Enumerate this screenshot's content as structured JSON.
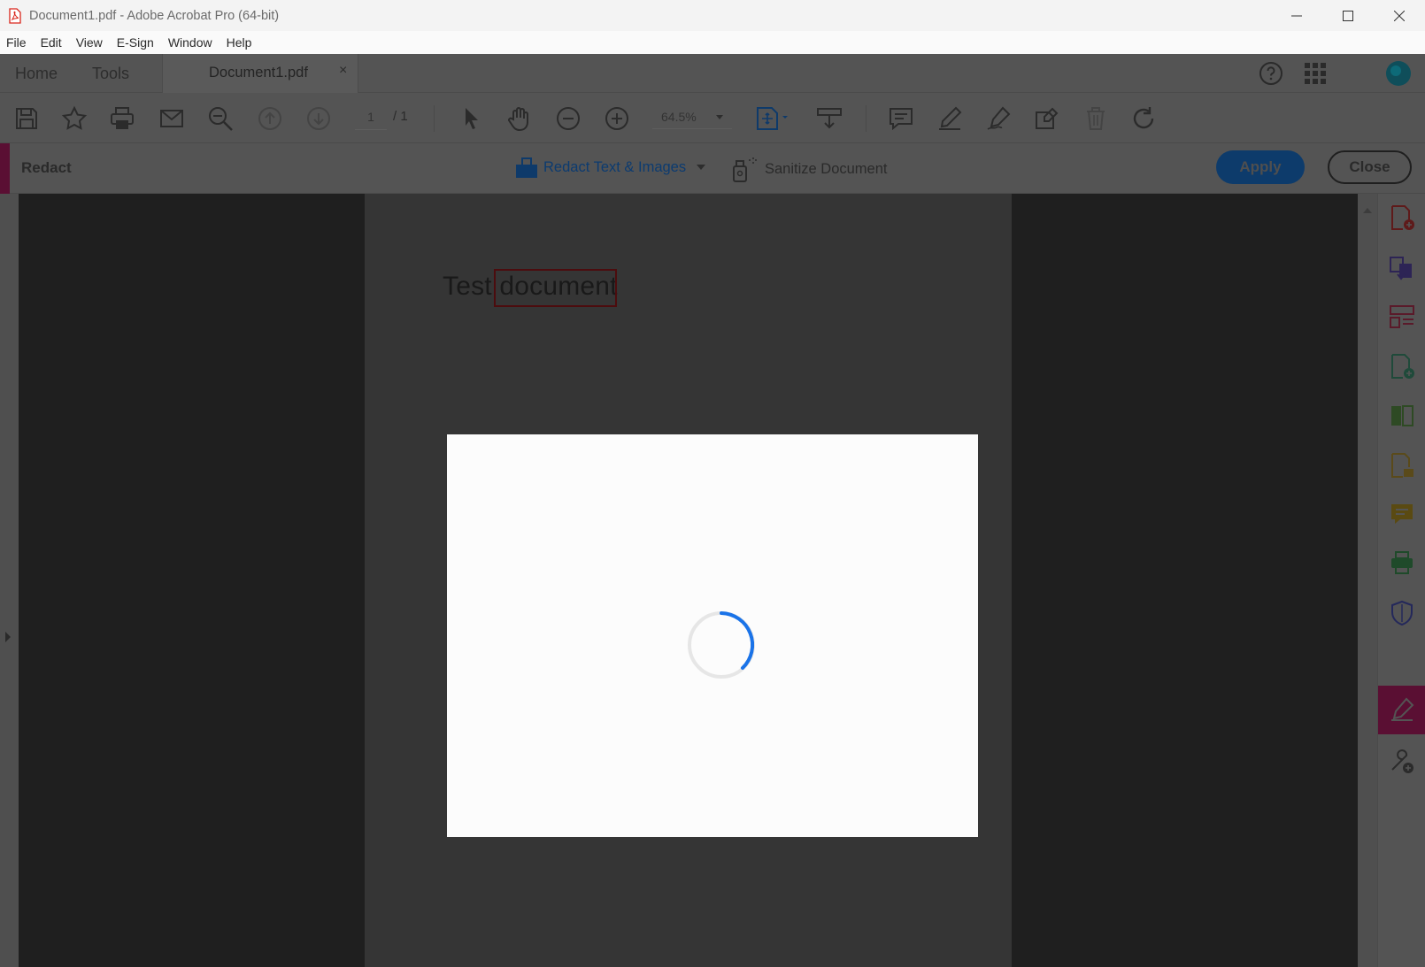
{
  "window": {
    "title": "Document1.pdf - Adobe Acrobat Pro (64-bit)",
    "controls": [
      "minimize-icon",
      "maximize-icon",
      "close-icon"
    ]
  },
  "menu": [
    "File",
    "Edit",
    "View",
    "E-Sign",
    "Window",
    "Help"
  ],
  "tabs": {
    "home": "Home",
    "tools": "Tools",
    "document": "Document1.pdf",
    "document_close": "×"
  },
  "toolbar": {
    "page_current": "1",
    "page_total": "/ 1",
    "zoom": "64.5%"
  },
  "redact": {
    "label": "Redact",
    "redact_tool": "Redact Text & Images",
    "sanitize_tool": "Sanitize Document",
    "apply": "Apply",
    "close": "Close"
  },
  "document": {
    "text_plain": "Test ",
    "text_marked": "document"
  },
  "colors": {
    "accent": "#5a0f33",
    "apply_button": "#0d3b6b",
    "spinner": "#1a73e8"
  }
}
